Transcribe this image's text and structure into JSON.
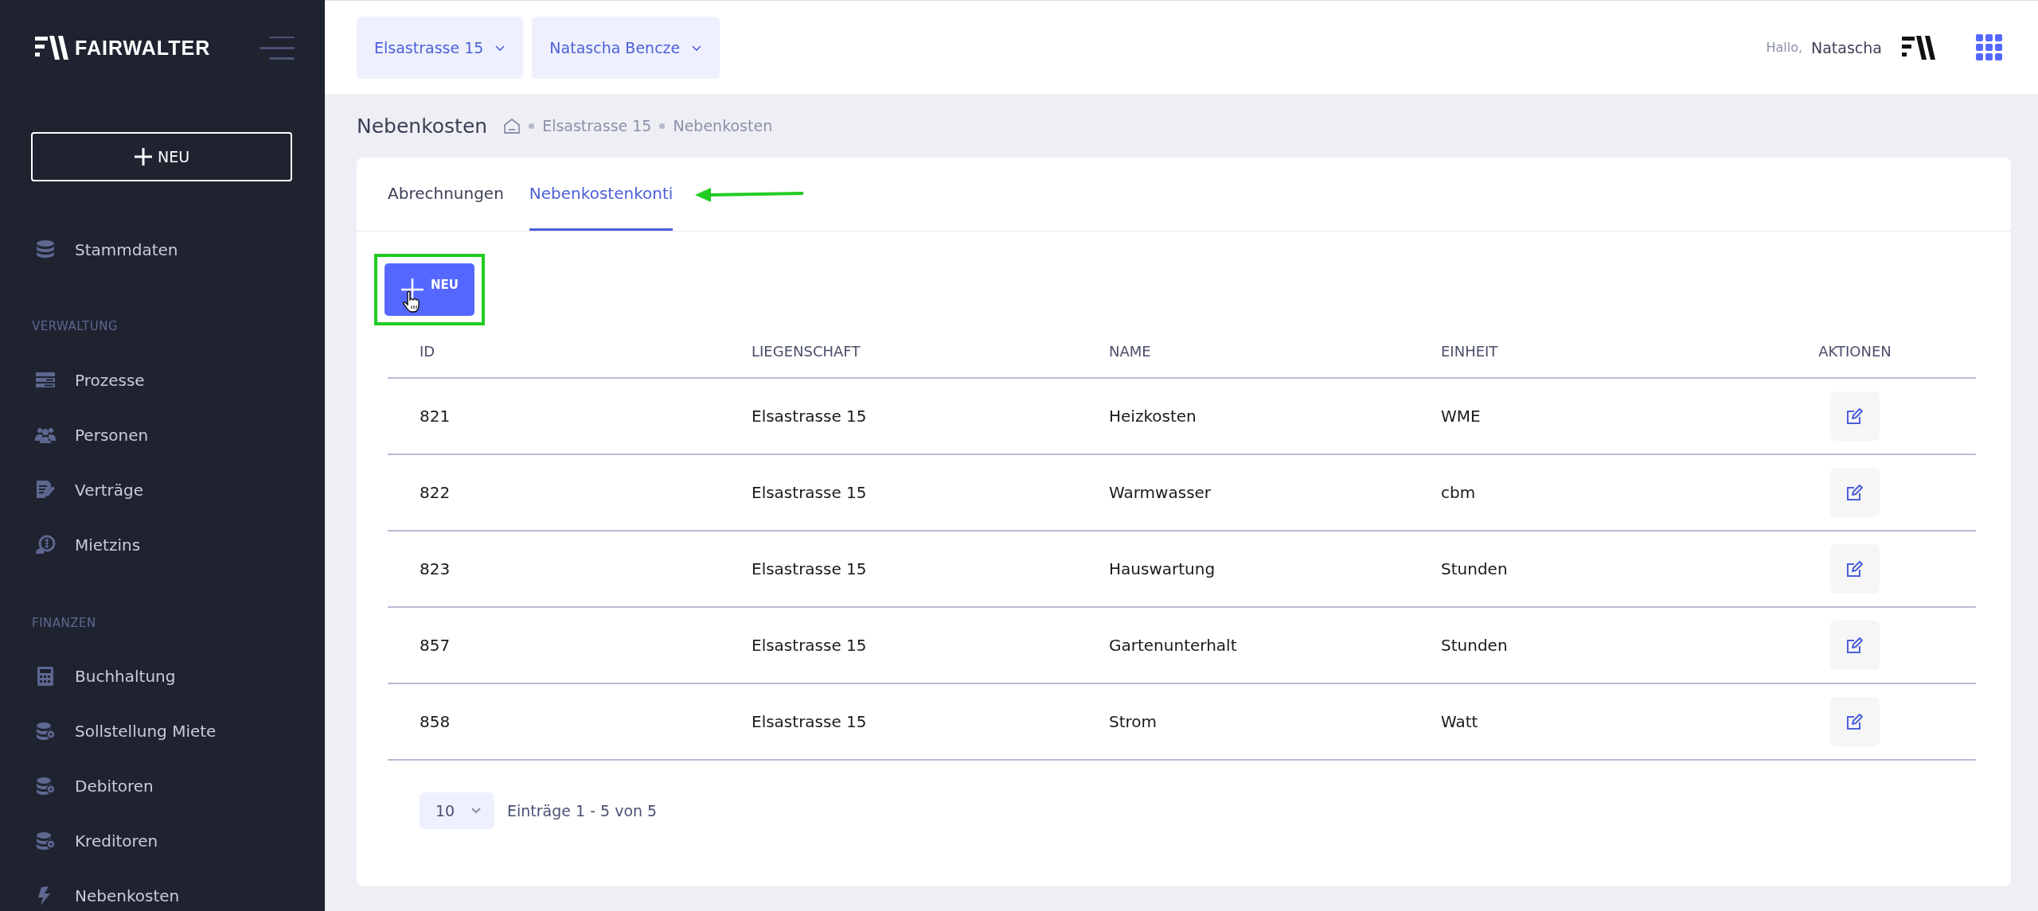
{
  "sidebar": {
    "logo_text": "FAIRWALTER",
    "new_button": "NEU",
    "top_items": [
      {
        "label": "Stammdaten",
        "selected": false
      }
    ],
    "sections": [
      {
        "title": "VERWALTUNG",
        "items": [
          {
            "label": "Prozesse",
            "selected": false
          },
          {
            "label": "Personen",
            "selected": false
          },
          {
            "label": "Verträge",
            "selected": false
          },
          {
            "label": "Mietzins",
            "selected": false
          }
        ]
      },
      {
        "title": "FINANZEN",
        "items": [
          {
            "label": "Buchhaltung",
            "selected": false
          },
          {
            "label": "Sollstellung Miete",
            "selected": false
          },
          {
            "label": "Debitoren",
            "selected": false
          },
          {
            "label": "Kreditoren",
            "selected": false
          },
          {
            "label": "Nebenkosten",
            "selected": false
          }
        ]
      }
    ]
  },
  "header": {
    "selectors": [
      "Elsastrasse 15",
      "Natascha Bencze"
    ],
    "greeting": "Hallo,",
    "user_name": "Natascha"
  },
  "page": {
    "title": "Nebenkosten",
    "breadcrumb": [
      "Elsastrasse 15",
      "Nebenkosten"
    ]
  },
  "tabs": [
    {
      "label": "Abrechnungen",
      "selected": false
    },
    {
      "label": "Nebenkostenkonti",
      "selected": true
    }
  ],
  "new_button": "NEU",
  "table": {
    "columns": [
      "ID",
      "LIEGENSCHAFT",
      "NAME",
      "EINHEIT",
      "AKTIONEN"
    ],
    "rows": [
      [
        "821",
        "Elsastrasse 15",
        "Heizkosten",
        "WME"
      ],
      [
        "822",
        "Elsastrasse 15",
        "Warmwasser",
        "cbm"
      ],
      [
        "823",
        "Elsastrasse 15",
        "Hauswartung",
        "Stunden"
      ],
      [
        "857",
        "Elsastrasse 15",
        "Gartenunterhalt",
        "Stunden"
      ],
      [
        "858",
        "Elsastrasse 15",
        "Strom",
        "Watt"
      ]
    ]
  },
  "pagination": {
    "page_size": "10",
    "summary": "Einträge 1 - 5 von 5"
  },
  "annotations": {
    "tab_arrow": true,
    "button_frame": true
  }
}
